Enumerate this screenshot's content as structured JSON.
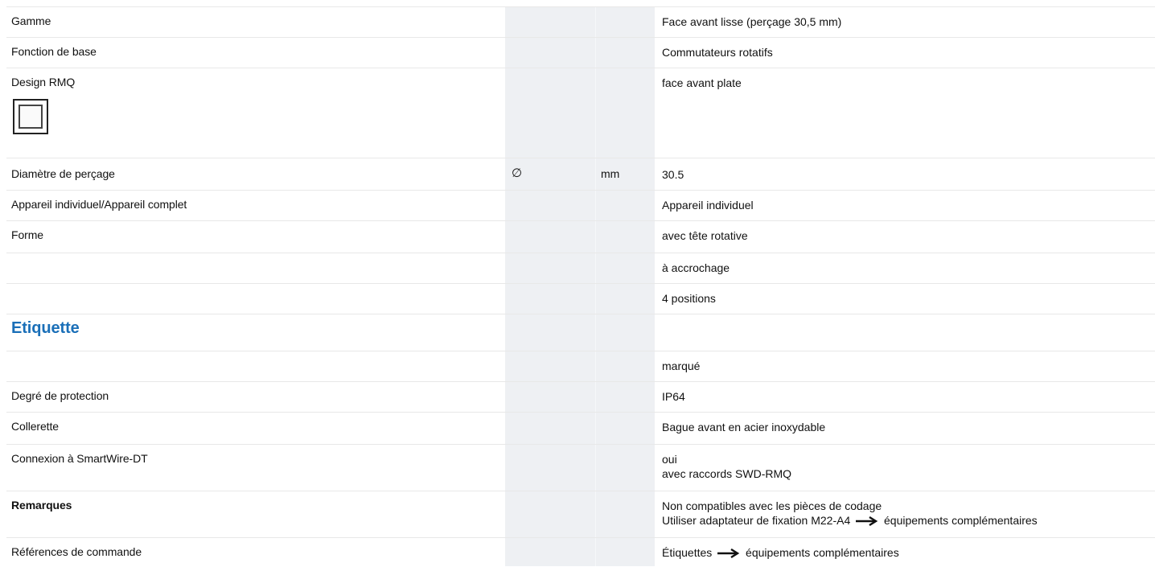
{
  "rows": [
    {
      "label": "Gamme",
      "value": "Face avant lisse (perçage 30,5 mm)"
    },
    {
      "label": "Fonction de base",
      "value": "Commutateurs rotatifs"
    },
    {
      "label": "Design RMQ",
      "value": "face avant plate",
      "icon": "rmq-flat-front-icon"
    },
    {
      "label": "Diamètre de perçage",
      "symbol": "∅",
      "unit": "mm",
      "value": "30.5"
    },
    {
      "label": "Appareil individuel/Appareil complet",
      "value": "Appareil individuel"
    },
    {
      "label": "Forme",
      "value": "avec tête rotative"
    },
    {
      "label": "",
      "value": "à accrochage"
    },
    {
      "label": "",
      "value": "4 positions"
    },
    {
      "heading": "Etiquette"
    },
    {
      "label": "",
      "value": "marqué"
    },
    {
      "label": "Degré de protection",
      "value": "IP64"
    },
    {
      "label": "Collerette",
      "value": "Bague avant en acier inoxydable"
    },
    {
      "label": "Connexion à SmartWire-DT",
      "value_lines": [
        "oui",
        "avec raccords SWD-RMQ"
      ]
    },
    {
      "label": "Remarques",
      "label_bold": true,
      "value_lines": [
        "Non compatibles avec les pièces de codage",
        "Utiliser adaptateur de fixation M22-A4",
        "équipements complémentaires"
      ]
    },
    {
      "label": "Références de commande",
      "value_parts": [
        "Étiquettes",
        "équipements complémentaires"
      ]
    }
  ],
  "colors": {
    "heading": "#1a6fb8",
    "shade": "#eef0f3"
  }
}
